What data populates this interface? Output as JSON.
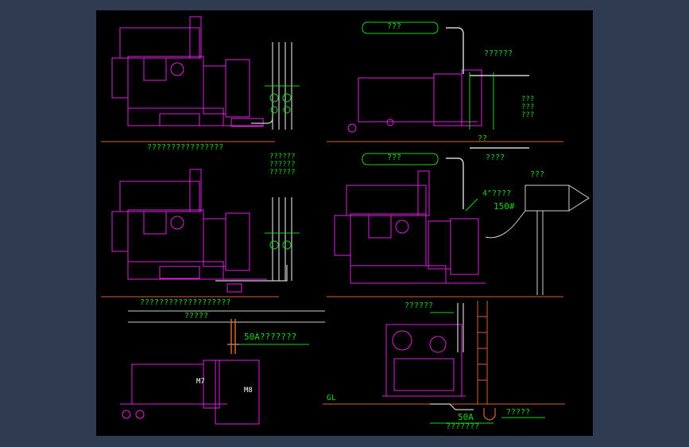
{
  "labels": {
    "unit1_title": "????????????????",
    "unit2_title": "???????????????????",
    "unit2_side_note": "??????\n??????\n??????",
    "insulation_top": "???",
    "valve_group": "??????",
    "unit3_side_note": "???\n???\n???",
    "unit3_pipe_a": "??",
    "unit3_pipe_b": "????",
    "insulation_middle": "???",
    "exhaust": "???",
    "pipe_size": "4\"????",
    "pipe_diameter": "150#",
    "bottom_left_title": "?????",
    "drain_50a_left": "50A???????",
    "m7": "M7",
    "m8": "M8",
    "bottom_right_title": "??????",
    "gl": "GL",
    "trap": "?????",
    "drain_50a_right": "50A",
    "drain_note": "???????"
  },
  "colors": {
    "background": "#2f3b50",
    "sheet": "#000000",
    "equipment": "#e020e0",
    "annotation": "#19d619",
    "ground": "#d4632a",
    "piping": "#d0d0d0"
  }
}
